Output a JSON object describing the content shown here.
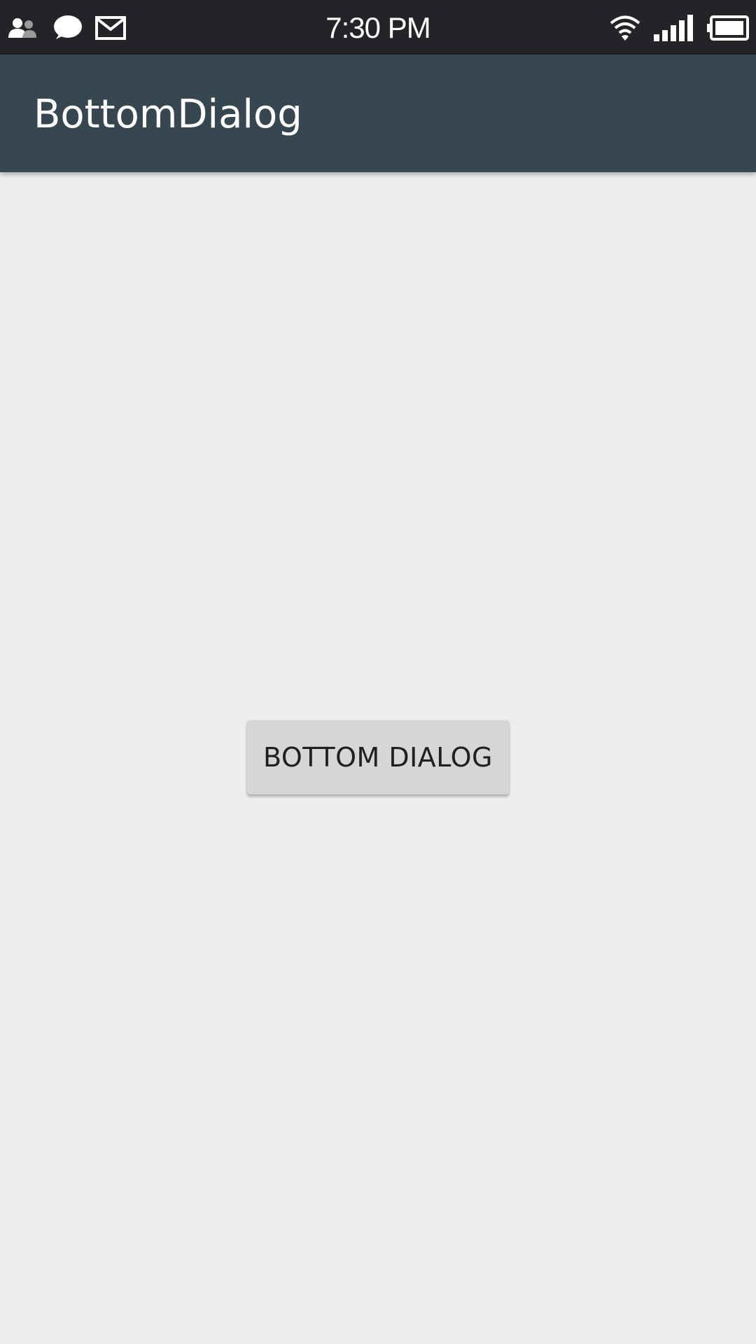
{
  "status_bar": {
    "time": "7:30 PM",
    "left_icons": [
      "contacts-icon",
      "chat-bubble-icon",
      "mail-icon"
    ],
    "right_icons": [
      "wifi-icon",
      "signal-icon",
      "battery-icon"
    ]
  },
  "app_bar": {
    "title": "BottomDialog",
    "color": "#37474f"
  },
  "main": {
    "button_label": "BOTTOM DIALOG"
  }
}
